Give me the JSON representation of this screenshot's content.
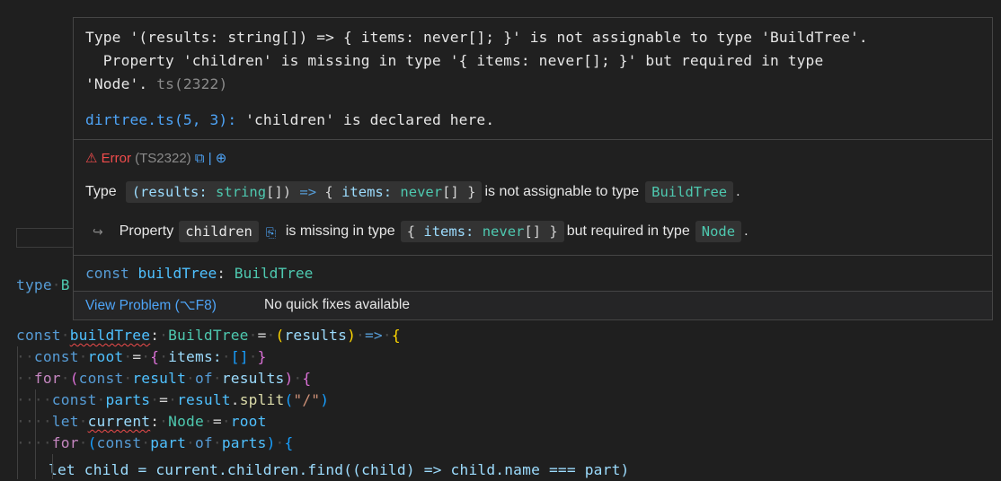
{
  "hover": {
    "message_line1": "Type '(results: string[]) => { items: never[]; }' is not assignable to type 'BuildTree'.",
    "message_line2": "  Property 'children' is missing in type '{ items: never[]; }' but required in type",
    "message_line3": "'Node'.",
    "message_code": "ts(2322)",
    "related_location": "dirtree.ts(5, 3):",
    "related_text": " 'children' is declared here.",
    "error_label": "⚠ Error",
    "error_code": "(TS2322)",
    "error_icons": "⧉ | ⊕",
    "pretty_line1": {
      "prefix": "Type",
      "chip1": {
        "part1": "(results:",
        "part2": "string",
        "part3": "[])",
        "part4": "=>",
        "part5": "{",
        "part6": "items:",
        "part7": "never",
        "part8": "[]",
        "part9": "}"
      },
      "middle": "is not assignable to type",
      "chip2": "BuildTree",
      "suffix": "."
    },
    "pretty_line2": {
      "arrow": "↪",
      "prefix": "Property",
      "chip1": "children",
      "copy_icon": "⎘",
      "middle": "is missing in type",
      "chip2": {
        "part1": "{",
        "part2": "items:",
        "part3": "never",
        "part4": "[]",
        "part5": "}"
      },
      "middle2": "but required in type",
      "chip3": "Node",
      "suffix": "."
    },
    "signature": {
      "kw": "const",
      "name": "buildTree",
      "colon": ":",
      "type": "BuildTree"
    },
    "footer": {
      "view_problem": "View Problem (⌥F8)",
      "no_fixes": "No quick fixes available"
    }
  },
  "code": {
    "partial_line": {
      "kw": "type",
      "name": "B"
    },
    "lines": [
      {
        "t1": "const",
        "t2": "buildTree",
        "t3": ":",
        "t4": "BuildTree",
        "t5": "=",
        "t6": "(",
        "t7": "results",
        "t8": ")",
        "t9": "=>",
        "t10": "{"
      },
      {
        "t1": "const",
        "t2": "root",
        "t3": "=",
        "t4": "{",
        "t5": "items:",
        "t6": "[]",
        "t7": "}"
      },
      {
        "t1": "for",
        "t2": "(",
        "t3": "const",
        "t4": "result",
        "t5": "of",
        "t6": "results",
        "t7": ")",
        "t8": "{"
      },
      {
        "t1": "const",
        "t2": "parts",
        "t3": "=",
        "t4": "result",
        "t5": ".",
        "t6": "split",
        "t7": "(",
        "t8": "\"/\"",
        "t9": ")"
      },
      {
        "t1": "let",
        "t2": "current",
        "t3": ":",
        "t4": "Node",
        "t5": "=",
        "t6": "root"
      },
      {
        "t1": "for",
        "t2": "(",
        "t3": "const",
        "t4": "part",
        "t5": "of",
        "t6": "parts",
        "t7": ")",
        "t8": "{"
      },
      {
        "text": "let child = current.children.find((child) => child.name === part)"
      }
    ]
  },
  "colors": {
    "accent": "#4ea4f7",
    "error": "#f14c4c",
    "type": "#4ec9b0",
    "keyword": "#569cd6",
    "variable": "#9cdcfe",
    "constant": "#4fc1ff"
  }
}
